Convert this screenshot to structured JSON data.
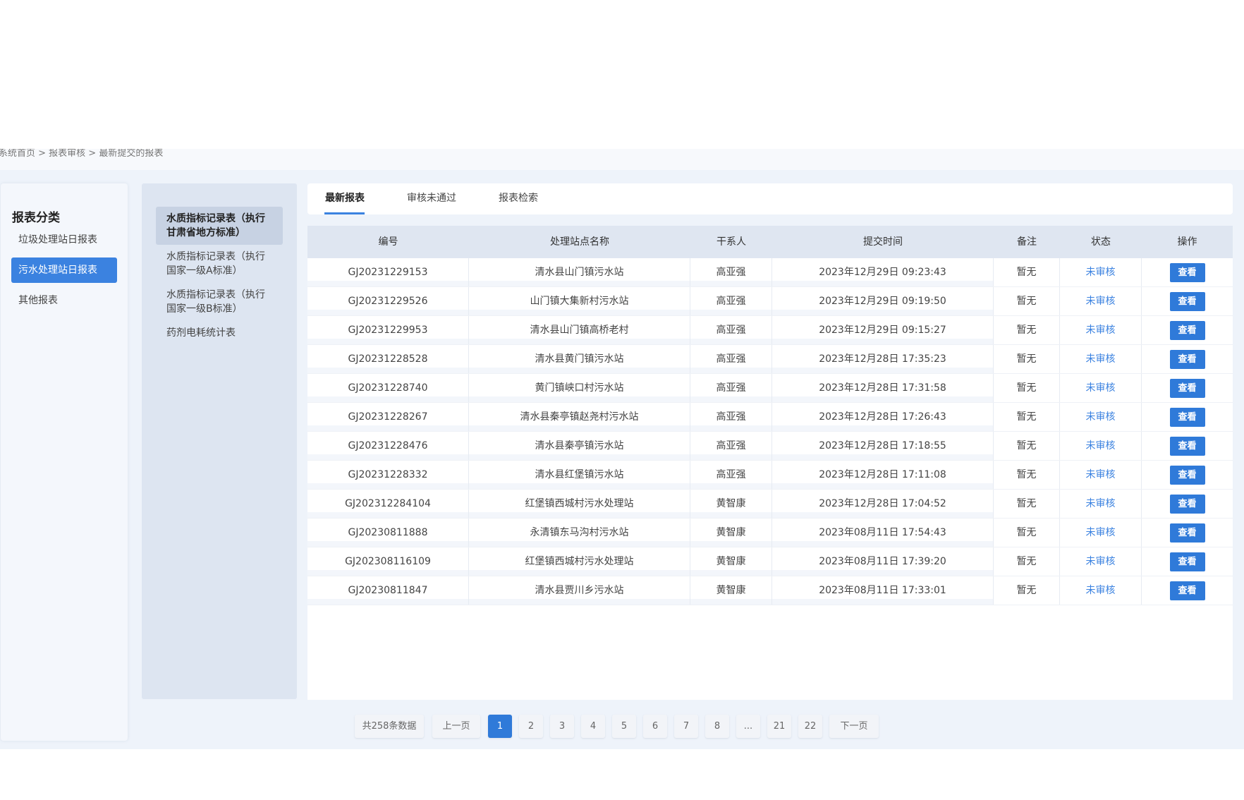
{
  "breadcrumb": "系统首页 > 报表审核 > 最新提交的报表",
  "left_panel": {
    "title": "报表分类",
    "items": [
      "垃圾处理站日报表",
      "污水处理站日报表",
      "其他报表"
    ]
  },
  "mid_panel": {
    "items": [
      "水质指标记录表（执行甘肃省地方标准）",
      "水质指标记录表（执行国家一级A标准）",
      "水质指标记录表（执行国家一级B标准）",
      "药剂电耗统计表"
    ]
  },
  "tabs": [
    "最新报表",
    "审核未通过",
    "报表检索"
  ],
  "table": {
    "headers": [
      "编号",
      "处理站点名称",
      "干系人",
      "提交时间",
      "备注",
      "状态",
      "操作"
    ],
    "rows": [
      {
        "id": "GJ20231229153",
        "station": "清水县山门镇污水站",
        "person": "高亚强",
        "time": "2023年12月29日 09:23:43",
        "note": "暂无",
        "status": "未审核",
        "action": "查看"
      },
      {
        "id": "GJ20231229526",
        "station": "山门镇大集新村污水站",
        "person": "高亚强",
        "time": "2023年12月29日 09:19:50",
        "note": "暂无",
        "status": "未审核",
        "action": "查看"
      },
      {
        "id": "GJ20231229953",
        "station": "清水县山门镇高桥老村",
        "person": "高亚强",
        "time": "2023年12月29日 09:15:27",
        "note": "暂无",
        "status": "未审核",
        "action": "查看"
      },
      {
        "id": "GJ20231228528",
        "station": "清水县黄门镇污水站",
        "person": "高亚强",
        "time": "2023年12月28日 17:35:23",
        "note": "暂无",
        "status": "未审核",
        "action": "查看"
      },
      {
        "id": "GJ20231228740",
        "station": "黄门镇峡口村污水站",
        "person": "高亚强",
        "time": "2023年12月28日 17:31:58",
        "note": "暂无",
        "status": "未审核",
        "action": "查看"
      },
      {
        "id": "GJ20231228267",
        "station": "清水县秦亭镇赵尧村污水站",
        "person": "高亚强",
        "time": "2023年12月28日 17:26:43",
        "note": "暂无",
        "status": "未审核",
        "action": "查看"
      },
      {
        "id": "GJ20231228476",
        "station": "清水县秦亭镇污水站",
        "person": "高亚强",
        "time": "2023年12月28日 17:18:55",
        "note": "暂无",
        "status": "未审核",
        "action": "查看"
      },
      {
        "id": "GJ20231228332",
        "station": "清水县红堡镇污水站",
        "person": "高亚强",
        "time": "2023年12月28日 17:11:08",
        "note": "暂无",
        "status": "未审核",
        "action": "查看"
      },
      {
        "id": "GJ202312284104",
        "station": "红堡镇西城村污水处理站",
        "person": "黄智康",
        "time": "2023年12月28日 17:04:52",
        "note": "暂无",
        "status": "未审核",
        "action": "查看"
      },
      {
        "id": "GJ20230811888",
        "station": "永清镇东马沟村污水站",
        "person": "黄智康",
        "time": "2023年08月11日 17:54:43",
        "note": "暂无",
        "status": "未审核",
        "action": "查看"
      },
      {
        "id": "GJ202308116109",
        "station": "红堡镇西城村污水处理站",
        "person": "黄智康",
        "time": "2023年08月11日 17:39:20",
        "note": "暂无",
        "status": "未审核",
        "action": "查看"
      },
      {
        "id": "GJ20230811847",
        "station": "清水县贾川乡污水站",
        "person": "黄智康",
        "time": "2023年08月11日 17:33:01",
        "note": "暂无",
        "status": "未审核",
        "action": "查看"
      }
    ]
  },
  "pagination": {
    "total": "共258条数据",
    "prev": "上一页",
    "pages": [
      "1",
      "2",
      "3",
      "4",
      "5",
      "6",
      "7",
      "8",
      "...",
      "21",
      "22"
    ],
    "current": "1",
    "next": "下一页"
  },
  "colors": {
    "accent": "#3b82e0",
    "button": "#2f7ad9",
    "header_bg": "#dfe6f1",
    "page_bg": "#eef3fa"
  }
}
